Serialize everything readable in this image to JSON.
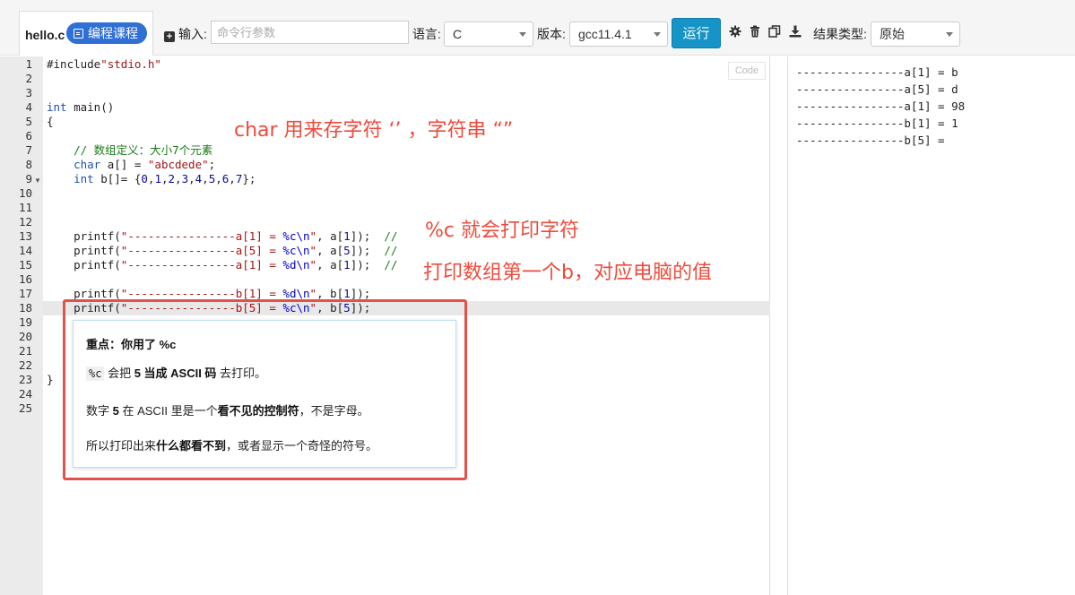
{
  "toolbar": {
    "file_name": "hello.c",
    "course_badge": "编程课程",
    "input_label": "输入:",
    "args_placeholder": "命令行参数",
    "language_label": "语言:",
    "language_value": "C",
    "version_label": "版本:",
    "version_value": "gcc11.4.1",
    "run_label": "运行",
    "result_type_label": "结果类型:",
    "result_type_value": "原始",
    "icons": [
      "gear-icon",
      "trash-icon",
      "copy-icon",
      "download-icon"
    ]
  },
  "editor": {
    "code_badge": "Code",
    "line_numbers": [
      "1",
      "2",
      "3",
      "4",
      "5",
      "6",
      "7",
      "8",
      "9",
      "10",
      "11",
      "12",
      "13",
      "14",
      "15",
      "16",
      "17",
      "18",
      "19",
      "20",
      "21",
      "22",
      "23",
      "24",
      "25"
    ],
    "lines": [
      {
        "n": "1",
        "parts": [
          [
            "pp",
            "#include"
          ],
          [
            "str",
            "\"stdio.h\""
          ]
        ]
      },
      {
        "n": "2",
        "parts": []
      },
      {
        "n": "3",
        "parts": []
      },
      {
        "n": "4",
        "parts": [
          [
            "kw",
            "int"
          ],
          [
            "t",
            " main()"
          ]
        ]
      },
      {
        "n": "5",
        "parts": [
          [
            "t",
            "{"
          ]
        ]
      },
      {
        "n": "6",
        "parts": []
      },
      {
        "n": "7",
        "parts": [
          [
            "t",
            "    "
          ],
          [
            "cm",
            "// 数组定义：大小7个元素"
          ]
        ]
      },
      {
        "n": "8",
        "parts": [
          [
            "t",
            "    "
          ],
          [
            "kw",
            "char"
          ],
          [
            "t",
            " a[] = "
          ],
          [
            "str",
            "\"abcdede\""
          ],
          [
            "t",
            ";"
          ]
        ]
      },
      {
        "n": "9",
        "parts": [
          [
            "t",
            "    "
          ],
          [
            "kw",
            "int"
          ],
          [
            "t",
            " b[]= {"
          ],
          [
            "num",
            "0"
          ],
          [
            "t",
            ","
          ],
          [
            "num",
            "1"
          ],
          [
            "t",
            ","
          ],
          [
            "num",
            "2"
          ],
          [
            "t",
            ","
          ],
          [
            "num",
            "3"
          ],
          [
            "t",
            ","
          ],
          [
            "num",
            "4"
          ],
          [
            "t",
            ","
          ],
          [
            "num",
            "5"
          ],
          [
            "t",
            ","
          ],
          [
            "num",
            "6"
          ],
          [
            "t",
            ","
          ],
          [
            "num",
            "7"
          ],
          [
            "t",
            "};"
          ]
        ]
      },
      {
        "n": "10",
        "parts": []
      },
      {
        "n": "11",
        "parts": []
      },
      {
        "n": "12",
        "parts": []
      },
      {
        "n": "13",
        "parts": [
          [
            "t",
            "    printf("
          ],
          [
            "str",
            "\"----------------a[1] = "
          ],
          [
            "fmt",
            "%c\\n"
          ],
          [
            "str",
            "\""
          ],
          [
            "t",
            ", a["
          ],
          [
            "num",
            "1"
          ],
          [
            "t",
            "]);  "
          ],
          [
            "cm",
            "//"
          ]
        ]
      },
      {
        "n": "14",
        "parts": [
          [
            "t",
            "    printf("
          ],
          [
            "str",
            "\"----------------a[5] = "
          ],
          [
            "fmt",
            "%c\\n"
          ],
          [
            "str",
            "\""
          ],
          [
            "t",
            ", a["
          ],
          [
            "num",
            "5"
          ],
          [
            "t",
            "]);  "
          ],
          [
            "cm",
            "//"
          ]
        ]
      },
      {
        "n": "15",
        "parts": [
          [
            "t",
            "    printf("
          ],
          [
            "str",
            "\"----------------a[1] = "
          ],
          [
            "fmt",
            "%d\\n"
          ],
          [
            "str",
            "\""
          ],
          [
            "t",
            ", a["
          ],
          [
            "num",
            "1"
          ],
          [
            "t",
            "]);  "
          ],
          [
            "cm",
            "//"
          ]
        ]
      },
      {
        "n": "16",
        "parts": []
      },
      {
        "n": "17",
        "parts": [
          [
            "t",
            "    printf("
          ],
          [
            "str",
            "\"----------------b[1] = "
          ],
          [
            "fmt",
            "%d\\n"
          ],
          [
            "str",
            "\""
          ],
          [
            "t",
            ", b["
          ],
          [
            "num",
            "1"
          ],
          [
            "t",
            "]);"
          ]
        ]
      },
      {
        "n": "18",
        "parts": [
          [
            "t",
            "    printf("
          ],
          [
            "str",
            "\"----------------b[5] = "
          ],
          [
            "fmt",
            "%c\\n"
          ],
          [
            "str",
            "\""
          ],
          [
            "t",
            ", b["
          ],
          [
            "num",
            "5"
          ],
          [
            "t",
            "]);"
          ]
        ]
      },
      {
        "n": "19",
        "parts": []
      },
      {
        "n": "20",
        "parts": []
      },
      {
        "n": "21",
        "parts": []
      },
      {
        "n": "22",
        "parts": []
      },
      {
        "n": "23",
        "parts": [
          [
            "t",
            "}"
          ]
        ]
      },
      {
        "n": "24",
        "parts": []
      },
      {
        "n": "25",
        "parts": []
      }
    ],
    "highlighted_line": "18"
  },
  "annotations": {
    "note1": "char 用来存字符 ‘’ ，字符串 “”",
    "note2": "%c 就会打印字符",
    "note3": "打印数组第一个b，对应电脑的值"
  },
  "hint": {
    "title": "重点：你用了 %c",
    "l2_code": "%c",
    "l2_pre": " 会把 ",
    "l2_bold": "5 当成 ASCII 码",
    "l2_post": " 去打印。",
    "l3_pre": "数字 ",
    "l3_bold1": "5",
    "l3_mid": " 在 ASCII 里是一个",
    "l3_bold2": "看不见的控制符",
    "l3_post": "，不是字母。",
    "l4_pre": "所以打印出来",
    "l4_bold": "什么都看不到",
    "l4_post": "，或者显示一个奇怪的符号。"
  },
  "output": {
    "lines": [
      "----------------a[1] = b",
      "----------------a[5] = d",
      "----------------a[1] = 98",
      "----------------b[1] = 1",
      "----------------b[5] = "
    ]
  }
}
